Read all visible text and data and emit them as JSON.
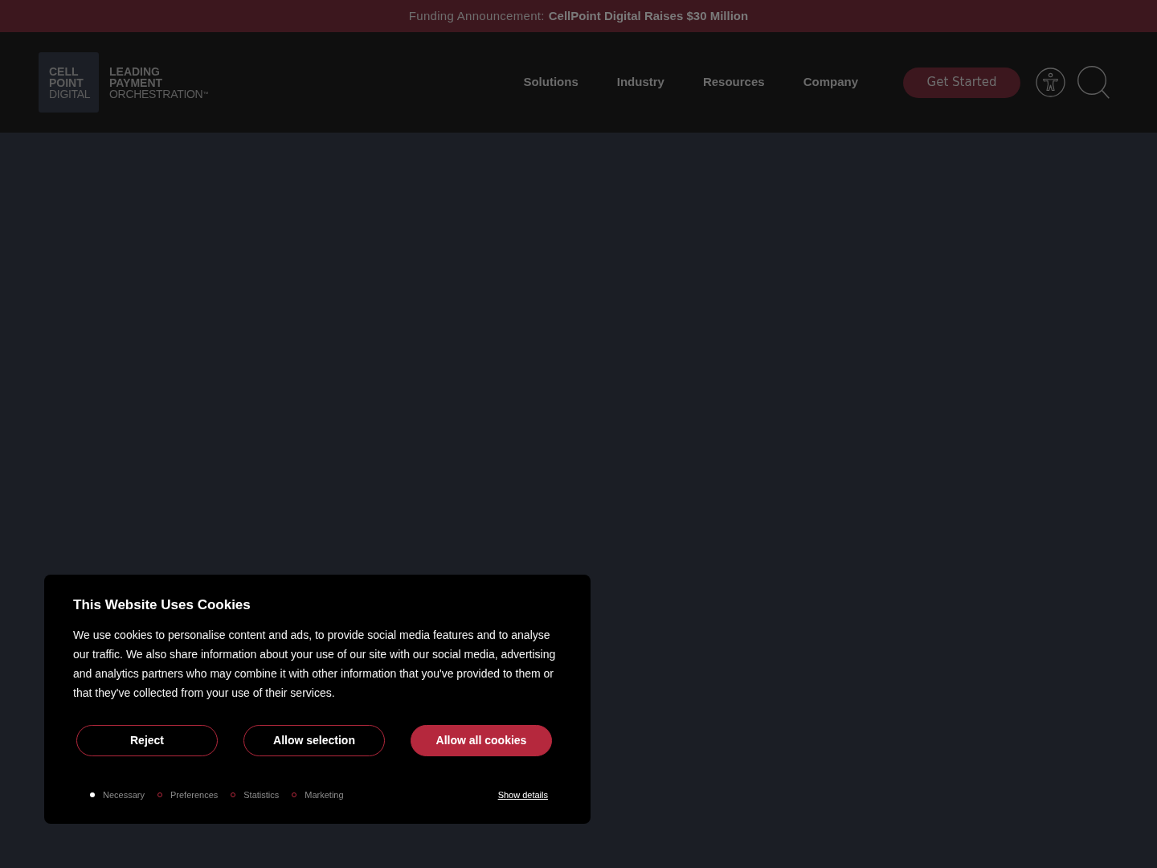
{
  "announcement": {
    "label": "Funding Announcement:",
    "link": "CellPoint Digital Raises $30 Million"
  },
  "header": {
    "logo": {
      "mark": [
        {
          "text": "CELL",
          "kind": "bold"
        },
        {
          "text": "POINT",
          "kind": "bold"
        },
        {
          "text": "DIGITAL",
          "kind": "light"
        }
      ],
      "tagline": [
        {
          "text": "LEADING",
          "kind": "bold"
        },
        {
          "text": "PAYMENT",
          "kind": "bold"
        },
        {
          "text": "ORCHESTRATION$^{™}$",
          "kind": "light"
        }
      ]
    },
    "nav": [
      "Solutions",
      "Industry",
      "Resources",
      "Company"
    ],
    "cta": "Get Started"
  },
  "cookie_banner": {
    "title": "This Website Uses Cookies",
    "body": "We use cookies to personalise content and ads, to provide social media features and to analyse our traffic. We also share information about your use of our site with our social media, advertising and analytics partners who may combine it with other information that you've provided to them or that they've collected from your use of their services.",
    "buttons": [
      {
        "label": "Reject",
        "kind": "outline"
      },
      {
        "label": "Allow selection",
        "kind": "outline"
      },
      {
        "label": "Allow all cookies",
        "kind": "filled"
      }
    ],
    "categories": [
      {
        "label": "Necessary",
        "checked": true
      },
      {
        "label": "Preferences",
        "checked": false
      },
      {
        "label": "Statistics",
        "checked": false
      },
      {
        "label": "Marketing",
        "checked": false
      }
    ],
    "details_link": "Show details"
  }
}
